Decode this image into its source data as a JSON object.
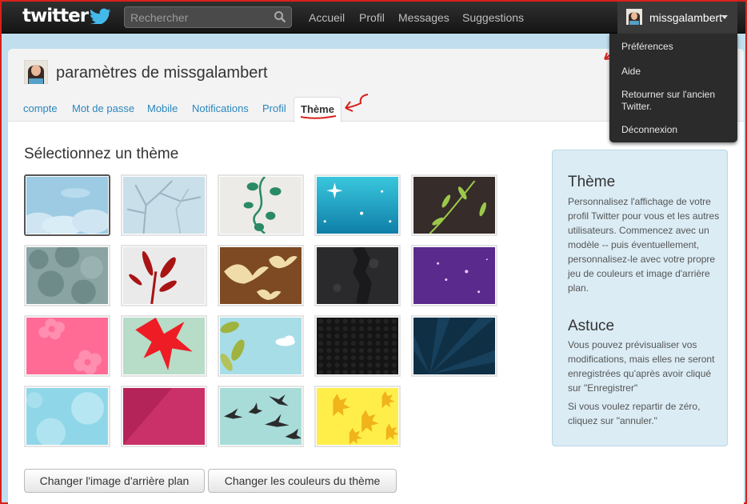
{
  "topbar": {
    "logo": "twitter",
    "search_placeholder": "Rechercher",
    "nav": [
      "Accueil",
      "Profil",
      "Messages",
      "Suggestions"
    ],
    "username": "missgalambert"
  },
  "user_menu": {
    "items": [
      "Préférences",
      "Aide",
      "Retourner sur l'ancien Twitter.",
      "Déconnexion"
    ]
  },
  "page": {
    "title": "paramètres de missgalambert",
    "tabs": [
      "compte",
      "Mot de passe",
      "Mobile",
      "Notifications",
      "Profil",
      "Thème"
    ],
    "active_tab": "Thème"
  },
  "themes": {
    "heading": "Sélectionnez un thème",
    "count": 19,
    "selected_index": 0
  },
  "buttons": {
    "change_background": "Changer l'image d'arrière plan",
    "change_colors": "Changer les couleurs du thème"
  },
  "sidebar": {
    "theme_title": "Thème",
    "theme_text": "Personnalisez l'affichage de votre profil Twitter pour vous et les autres utilisateurs. Commencez avec un modèle -- puis éventuellement, personnalisez-le avec votre propre jeu de couleurs et image d'arrière plan.",
    "tip_title": "Astuce",
    "tip_text1": "Vous pouvez prévisualiser vos modifications, mais elles ne seront enregistrées qu'après avoir cliqué sur \"Enregistrer\"",
    "tip_text2": "Si vous voulez repartir de zéro, cliquez sur \"annuler.\""
  },
  "colors": {
    "link": "#2a86bd",
    "topbar": "#1f1f1f",
    "annotation": "#d8211b"
  }
}
